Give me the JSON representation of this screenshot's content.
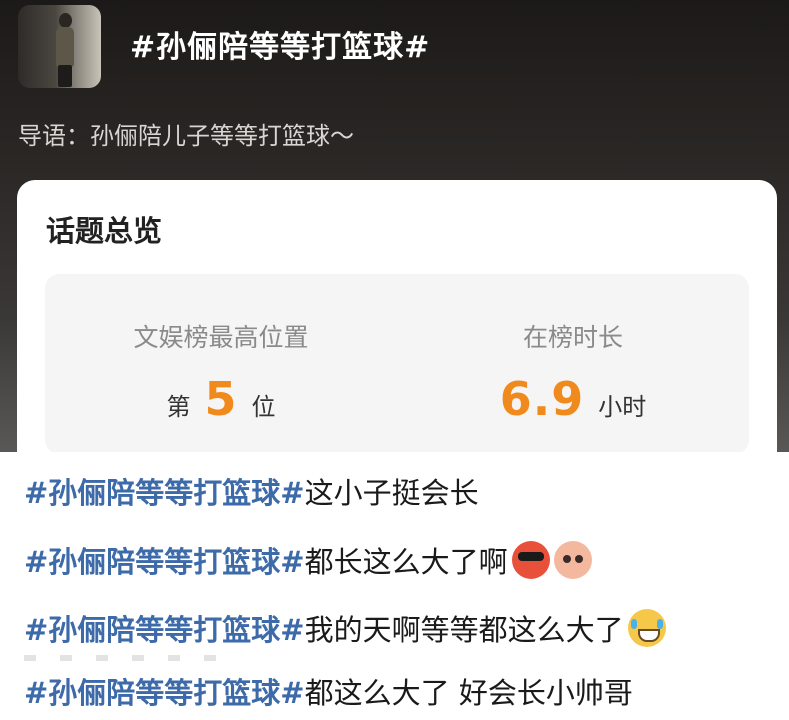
{
  "header": {
    "topic_title": "#孙俪陪等等打篮球#",
    "lead": "导语：孙俪陪儿子等等打篮球～"
  },
  "overview": {
    "title": "话题总览",
    "stats": [
      {
        "label": "文娱榜最高位置",
        "prefix": "第",
        "value": "5",
        "suffix": "位"
      },
      {
        "label": "在榜时长",
        "prefix": "",
        "value": "6.9",
        "suffix": "小时"
      }
    ]
  },
  "comments": [
    {
      "hashtag": "#孙俪陪等等打篮球#",
      "text": "这小子挺会长",
      "emojis": []
    },
    {
      "hashtag": "#孙俪陪等等打篮球#",
      "text": " 都长这么大了啊",
      "emojis": [
        "sunglasses-emoji",
        "shy-emoji"
      ]
    },
    {
      "hashtag": "#孙俪陪等等打篮球#",
      "text": "我的天啊等等都这么大了",
      "emojis": [
        "laugh-cry-emoji"
      ]
    },
    {
      "hashtag": "#孙俪陪等等打篮球#",
      "text": " 都这么大了 好会长小帅哥",
      "emojis": []
    }
  ],
  "colors": {
    "hashtag": "#3d6aa8",
    "stat_value": "#f08a1d",
    "header_bg": "#2a2725"
  }
}
